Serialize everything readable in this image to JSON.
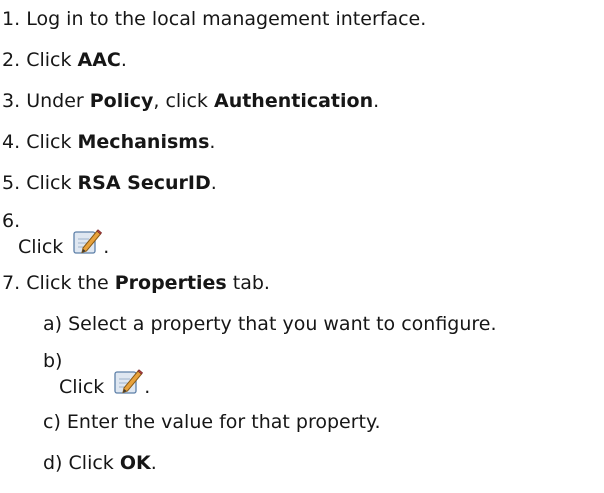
{
  "steps": {
    "s1": {
      "num": "1.",
      "text": "Log in to the local management interface."
    },
    "s2": {
      "num": "2.",
      "pre": "Click ",
      "bold": "AAC",
      "post": "."
    },
    "s3": {
      "num": "3.",
      "pre": "Under ",
      "bold1": "Policy",
      "mid": ", click ",
      "bold2": "Authentication",
      "post": "."
    },
    "s4": {
      "num": "4.",
      "pre": "Click ",
      "bold": "Mechanisms",
      "post": "."
    },
    "s5": {
      "num": "5.",
      "pre": "Click ",
      "bold": "RSA SecurID",
      "post": "."
    },
    "s6": {
      "num": "6.",
      "text": "Click",
      "post": ".",
      "icon": "edit-icon"
    },
    "s7": {
      "num": "7.",
      "pre": "Click the ",
      "bold": "Properties",
      "post": " tab."
    }
  },
  "substeps": {
    "a": {
      "num": "a)",
      "text": "Select a property that you want to configure."
    },
    "b": {
      "num": "b)",
      "text": "Click",
      "post": ".",
      "icon": "edit-icon"
    },
    "c": {
      "num": "c)",
      "text": "Enter the value for that property."
    },
    "d": {
      "num": "d)",
      "pre": "Click ",
      "bold": "OK",
      "post": "."
    }
  },
  "colors": {
    "text": "#161616",
    "icon_paper": "#dfe7f1",
    "icon_pencil": "#e8a23c"
  }
}
